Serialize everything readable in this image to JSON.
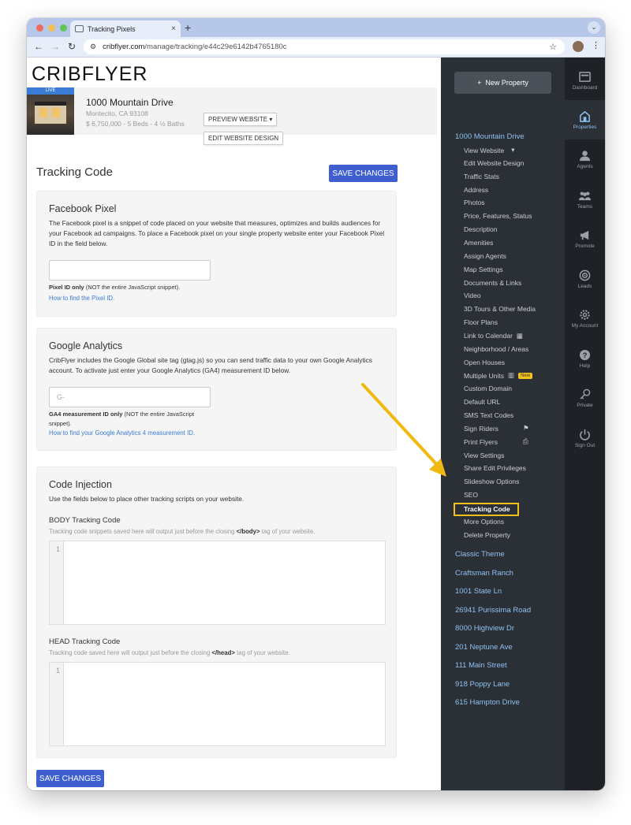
{
  "browser": {
    "tab_title": "Tracking Pixels",
    "url_host": "cribflyer.com",
    "url_path": "/manage/tracking/e44c29e6142b4765180c"
  },
  "header": {
    "logo": "CRIBFLYER",
    "live_badge": "LIVE",
    "property_title": "1000 Mountain Drive",
    "property_city": "Montecito, CA 93108",
    "property_details": "$ 6,750,000 - 5 Beds - 4 ½ Baths",
    "preview_label": "PREVIEW WEBSITE ▾",
    "edit_design_label": "EDIT WEBSITE DESIGN"
  },
  "page": {
    "title": "Tracking Code",
    "save_label": "SAVE CHANGES"
  },
  "facebook": {
    "title": "Facebook Pixel",
    "desc": "The Facebook pixel is a snippet of code placed on your website that measures, optimizes and builds audiences for your Facebook ad campaigns. To place a Facebook pixel on your single property website enter your Facebook Pixel ID in the field below.",
    "input_value": "",
    "help_bold": "Pixel ID only",
    "help_rest": " (NOT the entire JavaScript snippet).",
    "link": "How to find the Pixel ID."
  },
  "google": {
    "title": "Google Analytics",
    "desc": "CribFlyer includes the Google Global site tag (gtag.js) so you can send traffic data to your own Google Analytics account. To activate just enter your Google Analytics (GA4) measurement ID below.",
    "placeholder": "G-",
    "help_bold": "GA4 measurement ID only",
    "help_rest": " (NOT the entire JavaScript snippet).",
    "link": "How to find your Google Analytics 4 measurement ID."
  },
  "injection": {
    "title": "Code Injection",
    "desc": "Use the fields below to place other tracking scripts on your website.",
    "body_label": "BODY Tracking Code",
    "body_note_pre": "Tracking code snippets saved here will output just before the closing ",
    "body_note_tag": "</body>",
    "body_note_post": " tag of your website.",
    "head_label": "HEAD Tracking Code",
    "head_note_pre": "Tracking code saved here will output just before the closing ",
    "head_note_tag": "</head>",
    "head_note_post": " tag of your website.",
    "line_number": "1"
  },
  "sidebar": {
    "new_property": "New Property",
    "current_property": "1000 Mountain Drive",
    "items": [
      "View Website",
      "Edit Website Design",
      "Traffic Stats",
      "Address",
      "Photos",
      "Price, Features, Status",
      "Description",
      "Amenities",
      "Assign Agents",
      "Map Settings",
      "Documents & Links",
      "Video",
      "3D Tours & Other Media",
      "Floor Plans",
      "Link to Calendar",
      "Neighborhood / Areas",
      "Open Houses",
      "Multiple Units",
      "Custom Domain",
      "Default URL",
      "SMS Text Codes",
      "Sign Riders",
      "Print Flyers",
      "View Settings",
      "Share Edit Privileges",
      "Slideshow Options",
      "SEO",
      "Tracking Code",
      "More Options",
      "Delete Property"
    ],
    "new_badge": "New",
    "other_properties": [
      "Classic Theme",
      "Craftsman Ranch",
      "1001 State Ln",
      "26941 Purissima Road",
      "8000 Highview Dr",
      "201 Neptune Ave",
      "111 Main Street",
      "918 Poppy Lane",
      "615 Hampton Drive"
    ]
  },
  "rail": {
    "dashboard": "Dashboard",
    "properties": "Properties",
    "agents": "Agents",
    "teams": "Teams",
    "promote": "Promote",
    "leads": "Leads",
    "my_account": "My Account",
    "help": "Help",
    "private": "Private",
    "sign_out": "Sign Out"
  },
  "colors": {
    "accent": "#3f5fcf",
    "sidebar_bg": "#2b3036",
    "rail_bg": "#1e2227",
    "link_blue": "#8fc0f0",
    "highlight": "#f5c21b"
  }
}
